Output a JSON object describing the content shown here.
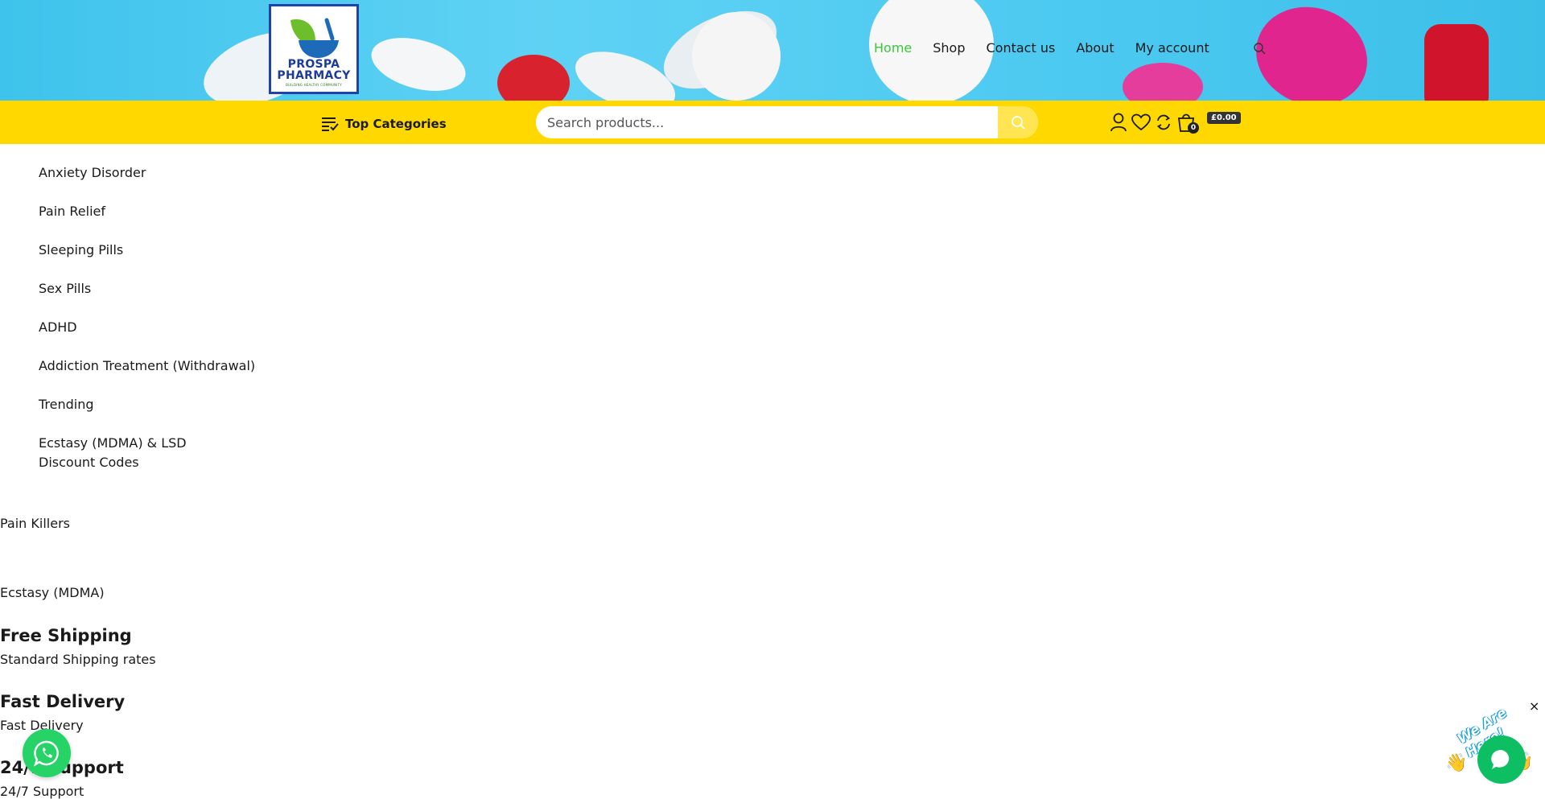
{
  "brand": {
    "line1": "PROSPA",
    "line2": "PHARMACY",
    "tagline": "BUILDING HEALTHY COMMUNITY"
  },
  "nav": {
    "items": [
      "Home",
      "Shop",
      "Contact us",
      "About",
      "My account"
    ],
    "active": "Home",
    "active_color": "#3ac73a"
  },
  "toolbar": {
    "categories_label": "Top Categories",
    "search_placeholder": "Search products...",
    "cart_count": "0",
    "cart_total": "£0.00",
    "bar_color": "#ffd800"
  },
  "categories": [
    "Anxiety Disorder",
    "Pain Relief",
    "Sleeping Pills",
    "Sex Pills",
    "ADHD",
    "Addiction Treatment (Withdrawal)",
    "Trending",
    "Ecstasy (MDMA) & LSD",
    "Discount Codes"
  ],
  "content": {
    "pain_killers": "Pain Killers",
    "ecstasy": "Ecstasy (MDMA)",
    "features": [
      {
        "title": "Free Shipping",
        "subtitle": "Standard Shipping rates"
      },
      {
        "title": "Fast Delivery",
        "subtitle": "Fast Delivery"
      },
      {
        "title": "24/7 Support",
        "subtitle": "24/7 Support"
      }
    ]
  },
  "chat": {
    "label": "We Are Here!",
    "close": "×"
  },
  "icons": [
    "search-icon",
    "user-icon",
    "heart-icon",
    "compare-icon",
    "cart-icon",
    "whatsapp-icon",
    "chat-icon",
    "close-icon",
    "categories-list-icon"
  ]
}
